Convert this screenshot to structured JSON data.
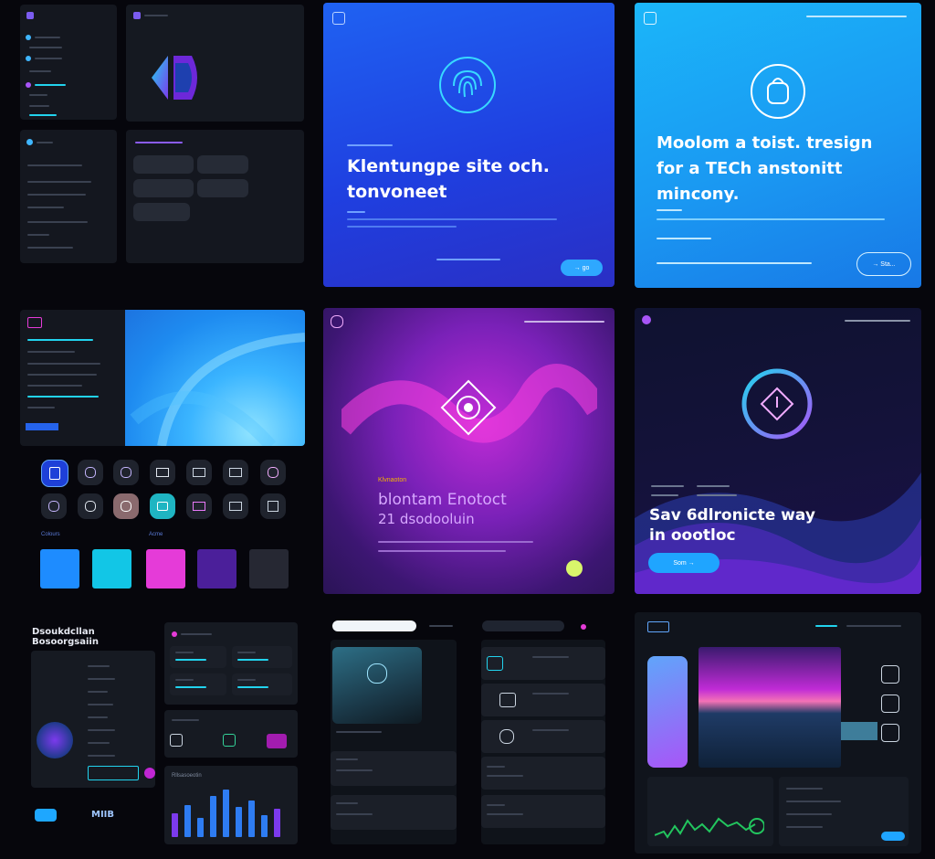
{
  "hero_blue": {
    "title_line1": "Klentungpe site och.",
    "title_line2": "tonvoneet",
    "button_label": "→ go"
  },
  "hero_cyan": {
    "title_line1": "Moolom a toist. tresign",
    "title_line2": "for a TECh anstonitt",
    "title_line3": "mincony.",
    "button_label": "→ Sta..."
  },
  "hero_purple": {
    "eyebrow": "Klvnaoton",
    "title_line1": "blontam Enotoct",
    "title_line2": "21 dsodooluin"
  },
  "hero_dark": {
    "title_line1": "Sav 6dlronicte way",
    "title_line2": "in oootloc",
    "button_label": "Som →"
  },
  "ui_kit": {
    "swatch_label_1": "Colours",
    "swatch_label_2": "Acme",
    "swatches": [
      "#1e8cff",
      "#12c6e6",
      "#e53bd8",
      "#4b1f9a",
      "#262833"
    ]
  },
  "dashboard": {
    "title_line1": "Dsoukdcllan",
    "title_line2": "Bosoorgsaiin",
    "stat_value": "MIIB",
    "chart_title": "Rllsasoeotin",
    "bars": [
      22,
      30,
      18,
      38,
      44,
      28,
      34,
      20,
      26
    ]
  },
  "colors": {
    "bg": "#06060c",
    "blue_hero": "#1f4fe6",
    "cyan_hero": "#16a4f5",
    "purple_hero": "#7a21b8",
    "dark_hero": "#14123a",
    "accent_cyan": "#22d3ee",
    "accent_magenta": "#e53bd8"
  }
}
